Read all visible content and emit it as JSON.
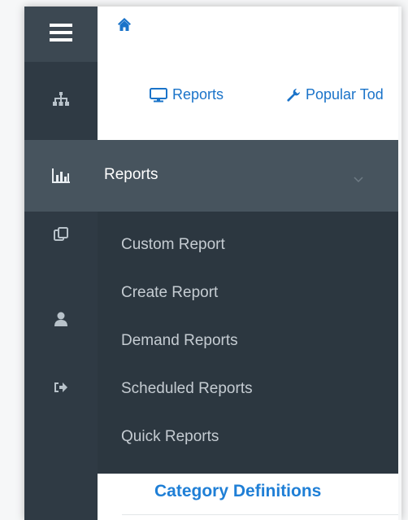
{
  "tabs": {
    "reports_label": "Reports",
    "popular_label": "Popular Tod"
  },
  "reports_menu": {
    "title": "Reports",
    "items": [
      {
        "label": "Custom Report"
      },
      {
        "label": "Create Report"
      },
      {
        "label": "Demand Reports"
      },
      {
        "label": "Scheduled Reports"
      },
      {
        "label": "Quick Reports"
      }
    ]
  },
  "content": {
    "heading": "Category Definitions"
  },
  "icons": {
    "hamburger": "hamburger-icon",
    "sitemap": "sitemap-icon",
    "bar_chart": "bar-chart-icon",
    "copy": "copy-icon",
    "user": "user-icon",
    "sign_out": "sign-out-icon",
    "home": "home-icon",
    "monitor": "monitor-icon",
    "wrench": "wrench-icon",
    "chevron": "chevron-down-icon"
  },
  "colors": {
    "rail": "#2f3a44",
    "menu_header": "#47545e",
    "submenu": "#2c3740",
    "link_blue": "#1a73c9"
  }
}
